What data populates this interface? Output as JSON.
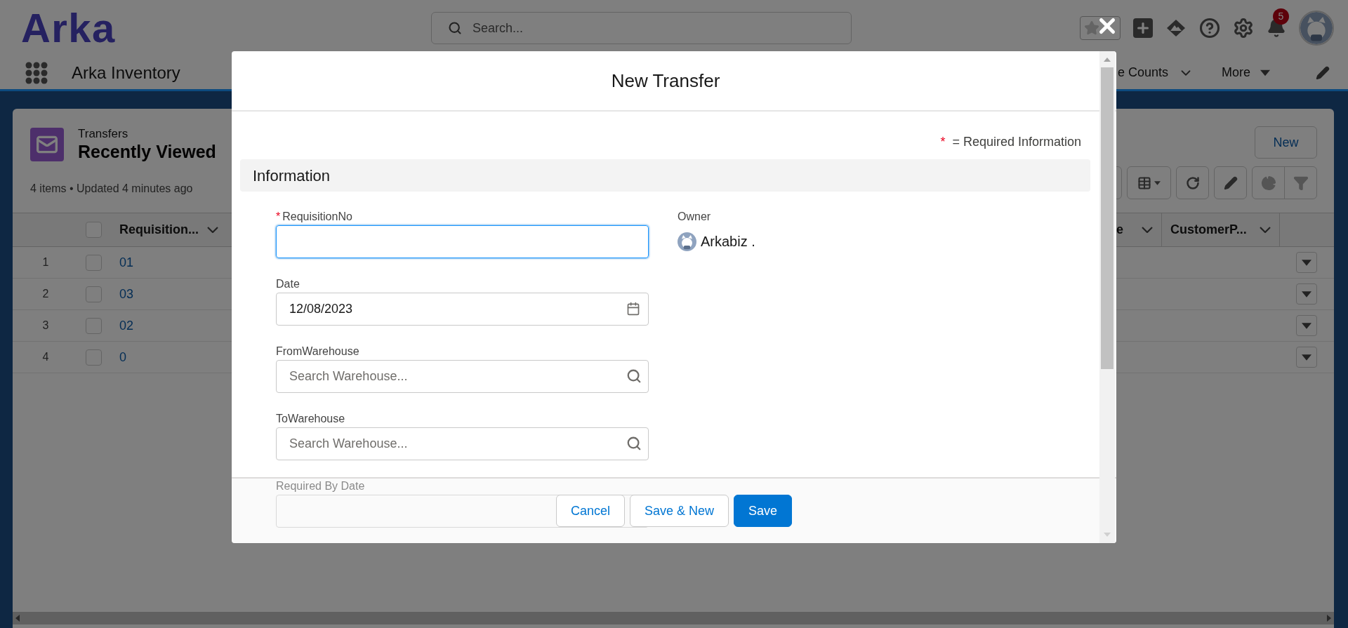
{
  "header": {
    "logo": "Arka",
    "search": {
      "placeholder": "Search..."
    },
    "notifications_badge": "5"
  },
  "nav": {
    "app_name": "Arka Inventory",
    "items": [
      {
        "label": "e Counts",
        "kind": "menu"
      },
      {
        "label": "More",
        "kind": "more"
      }
    ]
  },
  "list_view": {
    "object": "Transfers",
    "title": "Recently Viewed",
    "meta": "4 items • Updated 4 minutes ago",
    "new_button": "New",
    "select_all_checked": false,
    "columns": [
      "Requisition...",
      "e",
      "CustomerP..."
    ],
    "rows": [
      {
        "number": "1",
        "requisition": "01",
        "checked": false
      },
      {
        "number": "2",
        "requisition": "03",
        "checked": false
      },
      {
        "number": "3",
        "requisition": "02",
        "checked": false
      },
      {
        "number": "4",
        "requisition": "0",
        "checked": false
      }
    ]
  },
  "modal": {
    "title": "New Transfer",
    "required_note": {
      "mark": "*",
      "text": "= Required Information"
    },
    "section": "Information",
    "fields": [
      {
        "label": "RequisitionNo",
        "required_mark": "*",
        "kind": "text",
        "focused": true
      },
      {
        "label": "Date",
        "kind": "date",
        "value": "12/08/2023",
        "focused": false
      },
      {
        "label": "FromWarehouse",
        "kind": "lookup",
        "placeholder": "Search Warehouse...",
        "focused": false
      },
      {
        "label": "ToWarehouse",
        "kind": "lookup",
        "placeholder": "Search Warehouse...",
        "focused": false
      },
      {
        "label": "Required By Date",
        "kind": "date",
        "focused": false
      }
    ],
    "owner": {
      "label": "Owner",
      "name": "Arkabiz ."
    },
    "buttons": [
      {
        "label": "Cancel",
        "kind": "neutral"
      },
      {
        "label": "Save & New",
        "kind": "neutral"
      },
      {
        "label": "Save",
        "kind": "brand"
      }
    ]
  }
}
